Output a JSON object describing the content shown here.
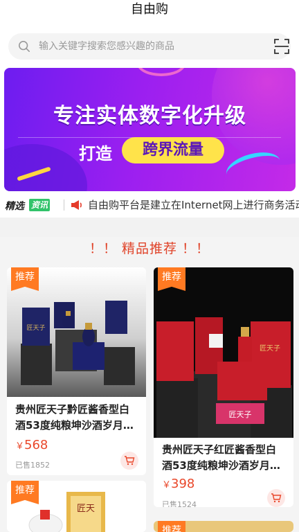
{
  "header": {
    "title": "自由购"
  },
  "search": {
    "placeholder": "输入关键字搜索您感兴趣的商品"
  },
  "banner": {
    "headline": "专注实体数字化升级",
    "sub_left": "打造",
    "sub_highlight": "跨界流量",
    "dots": 4,
    "active_dot": 1
  },
  "news": {
    "tag_left": "精选",
    "tag_right": "资讯",
    "text": "自由购平台是建立在Internet网上进行商务活动"
  },
  "section": {
    "title": "！！ 精品推荐 ！！"
  },
  "products": [
    {
      "badge": "推荐",
      "name_line1": "贵州匠天子黔匠酱香型白",
      "name_line2": "酒53度纯粮坤沙酒岁月…",
      "price_symbol": "￥",
      "price": "568",
      "sold": "已售1852"
    },
    {
      "badge": "推荐",
      "name_line1": "贵州匠天子红匠酱香型白",
      "name_line2": "酒53度纯粮坤沙酒岁月…",
      "price_symbol": "￥",
      "price": "398",
      "sold": "已售1524"
    },
    {
      "badge": "推荐"
    },
    {
      "badge": "推荐"
    }
  ],
  "colors": {
    "accent": "#e9472a",
    "badge": "#ff7a22",
    "green": "#32c36a"
  }
}
